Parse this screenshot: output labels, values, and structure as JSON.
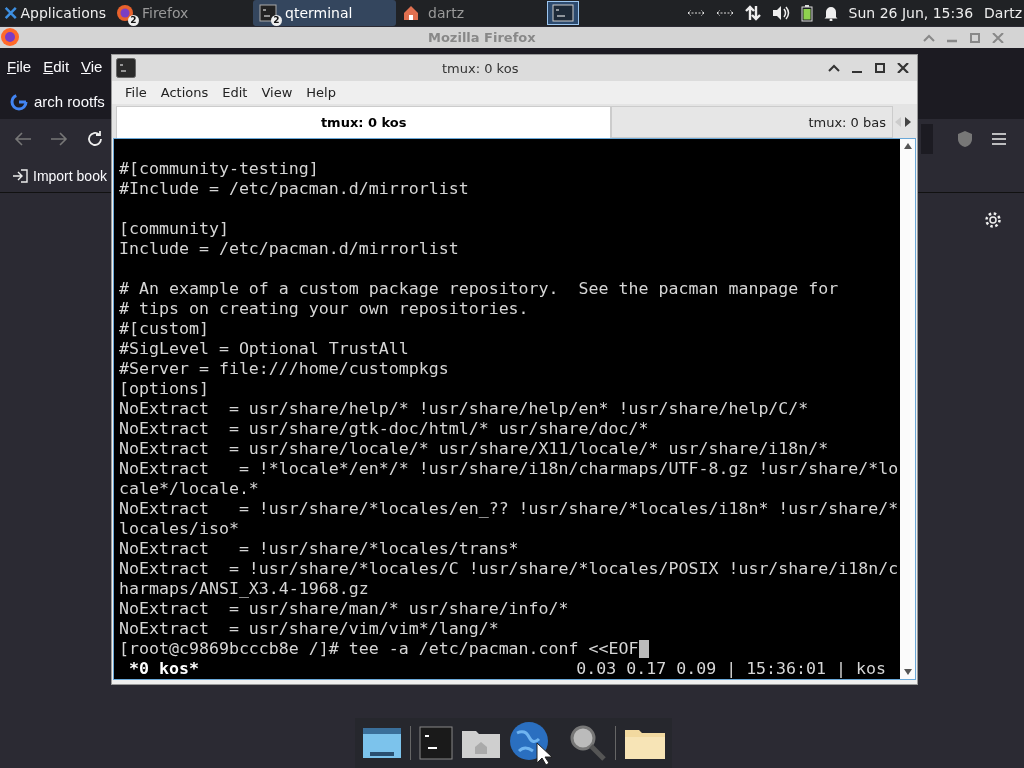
{
  "top_panel": {
    "menu_label": "Applications",
    "tasks": [
      {
        "kind": "browser",
        "label": "Firefox",
        "count": "2",
        "selected": false
      },
      {
        "kind": "terminal",
        "label": "qterminal",
        "count": "2",
        "selected": true
      },
      {
        "kind": "home",
        "label": "dartz",
        "selected": false
      }
    ],
    "clock": "Sun 26 Jun, 15:36",
    "user": "Dartz"
  },
  "browser": {
    "title": "Mozilla Firefox",
    "menu": [
      "File",
      "Edit",
      "Vie"
    ],
    "tab": "arch rootfs",
    "bookmark": "Import book"
  },
  "terminal": {
    "title": "tmux: 0 kos",
    "menu": [
      "File",
      "Actions",
      "Edit",
      "View",
      "Help"
    ],
    "tabs": [
      {
        "label": "tmux: 0 kos",
        "selected": true
      },
      {
        "label": "tmux: 0 bas",
        "selected": false
      }
    ],
    "paragraphs": [
      [
        "#[community-testing]",
        "#Include = /etc/pacman.d/mirrorlist"
      ],
      [
        "[community]",
        "Include = /etc/pacman.d/mirrorlist"
      ],
      [
        "# An example of a custom package repository.  See the pacman manpage for",
        "# tips on creating your own repositories.",
        "#[custom]",
        "#SigLevel = Optional TrustAll",
        "#Server = file:///home/custompkgs",
        "[options]",
        "NoExtract  = usr/share/help/* !usr/share/help/en* !usr/share/help/C/*",
        "NoExtract  = usr/share/gtk-doc/html/* usr/share/doc/*",
        "NoExtract  = usr/share/locale/* usr/share/X11/locale/* usr/share/i18n/*",
        "NoExtract   = !*locale*/en*/* !usr/share/i18n/charmaps/UTF-8.gz !usr/share/*lo",
        "cale*/locale.*",
        "NoExtract   = !usr/share/*locales/en_?? !usr/share/*locales/i18n* !usr/share/*",
        "locales/iso*",
        "NoExtract   = !usr/share/*locales/trans*",
        "NoExtract  = !usr/share/*locales/C !usr/share/*locales/POSIX !usr/share/i18n/c",
        "harmaps/ANSI_X3.4-1968.gz",
        "NoExtract  = usr/share/man/* usr/share/info/*",
        "NoExtract  = usr/share/vim/vim*/lang/*"
      ]
    ],
    "prompt": "[root@c9869bcccb8e /]# tee -a /etc/pacman.conf <<EOF",
    "status_left": "*0 kos*",
    "status_right": "0.03 0.17 0.09 | 15:36:01 | kos"
  }
}
